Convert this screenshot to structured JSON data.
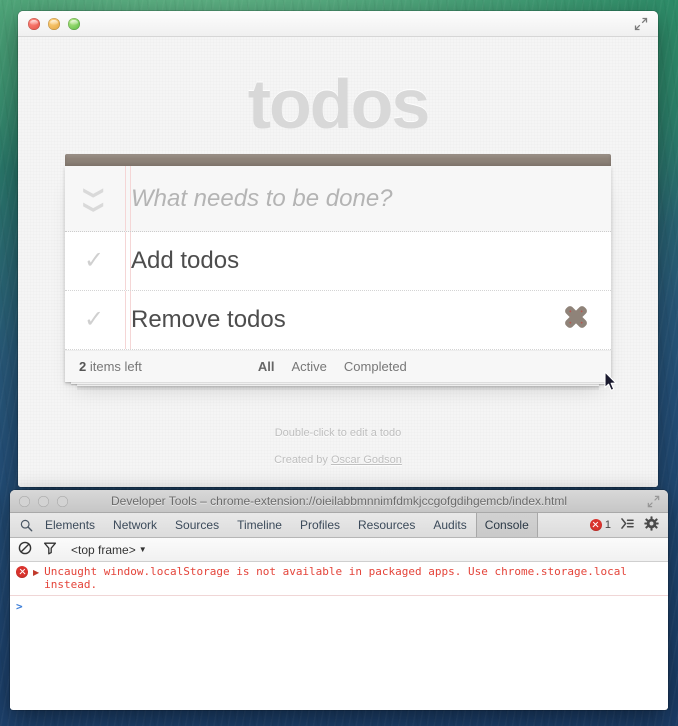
{
  "app_window": {
    "controls": {
      "close": "close-button",
      "minimize": "minimize-button",
      "maximize": "maximize-button"
    },
    "fullscreen_label": "Enter Full Screen",
    "title": "todos",
    "new_todo_placeholder": "What needs to be done?",
    "new_todo_value": "",
    "toggle_all_label": "Mark all as complete",
    "todos": [
      {
        "label": "Add todos",
        "completed": false
      },
      {
        "label": "Remove todos",
        "completed": false
      }
    ],
    "footer": {
      "count_number": "2",
      "count_text": "items left",
      "filters": [
        {
          "label": "All",
          "selected": true
        },
        {
          "label": "Active",
          "selected": false
        },
        {
          "label": "Completed",
          "selected": false
        }
      ]
    },
    "info": {
      "hint": "Double-click to edit a todo",
      "credit_prefix": "Created by ",
      "credit_author": "Oscar Godson"
    }
  },
  "devtools_window": {
    "title": "Developer Tools – chrome-extension://oieilabbmnnimfdmkjccgofgdihgemcb/index.html",
    "search_icon": "search-icon",
    "tabs": [
      {
        "label": "Elements",
        "active": false
      },
      {
        "label": "Network",
        "active": false
      },
      {
        "label": "Sources",
        "active": false
      },
      {
        "label": "Timeline",
        "active": false
      },
      {
        "label": "Profiles",
        "active": false
      },
      {
        "label": "Resources",
        "active": false
      },
      {
        "label": "Audits",
        "active": false
      },
      {
        "label": "Console",
        "active": true
      }
    ],
    "error_count": "1",
    "dock_icon": "dock-to-side-icon",
    "settings_icon": "gear-icon",
    "filter_bar": {
      "clear_icon": "clear-console-icon",
      "filter_icon": "filter-icon",
      "frame_label": "<top frame>",
      "frame_caret": "▼"
    },
    "console": {
      "error_message": "Uncaught window.localStorage is not available in packaged apps. Use chrome.storage.local instead.",
      "disclosure": "▶",
      "prompt": ">"
    },
    "colors": {
      "error_text": "#e4443a",
      "tab_text": "#3b4a5a",
      "prompt": "#3b7dd8"
    }
  }
}
